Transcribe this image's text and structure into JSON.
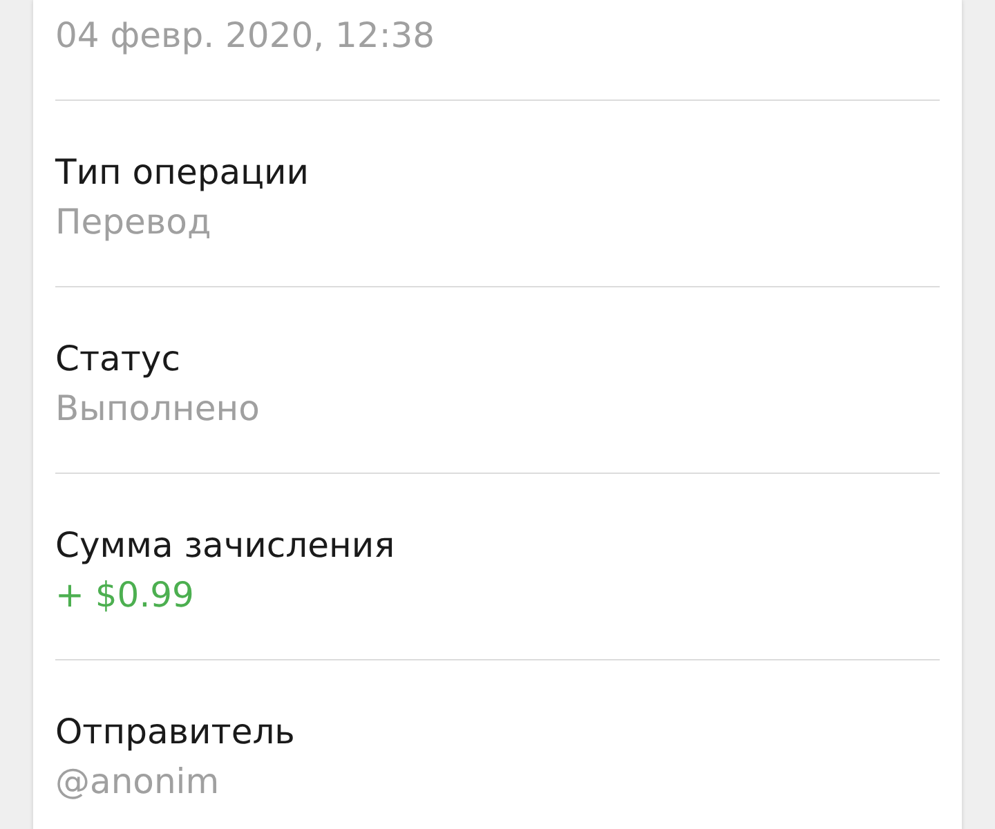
{
  "details": [
    {
      "value": "04 февр. 2020, 12:38",
      "kind": "plain"
    },
    {
      "label": "Тип операции",
      "value": "Перевод",
      "kind": "plain"
    },
    {
      "label": "Статус",
      "value": "Выполнено",
      "kind": "plain"
    },
    {
      "label": "Сумма зачисления",
      "value": "+ $0.99",
      "kind": "credit"
    },
    {
      "label": "Отправитель",
      "value": "@anonim",
      "kind": "plain"
    }
  ]
}
